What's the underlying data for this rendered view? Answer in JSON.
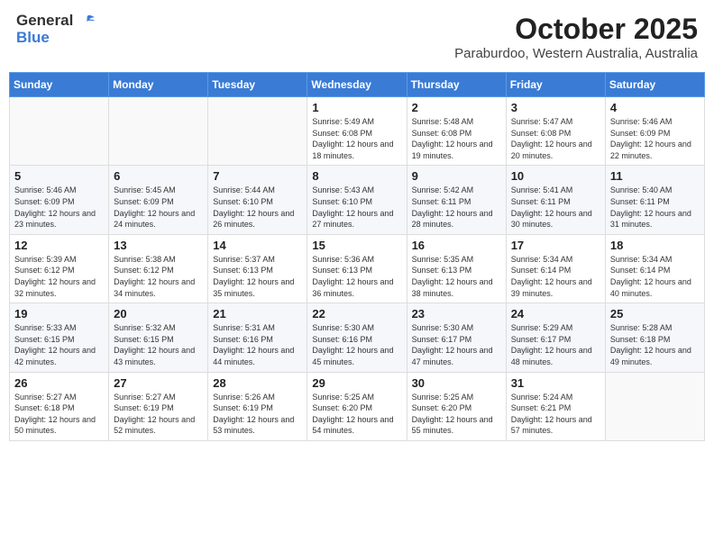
{
  "header": {
    "logo": {
      "general": "General",
      "blue": "Blue"
    },
    "title": "October 2025",
    "location": "Paraburdoo, Western Australia, Australia"
  },
  "calendar": {
    "weekdays": [
      "Sunday",
      "Monday",
      "Tuesday",
      "Wednesday",
      "Thursday",
      "Friday",
      "Saturday"
    ],
    "weeks": [
      [
        {
          "day": "",
          "info": ""
        },
        {
          "day": "",
          "info": ""
        },
        {
          "day": "",
          "info": ""
        },
        {
          "day": "1",
          "info": "Sunrise: 5:49 AM\nSunset: 6:08 PM\nDaylight: 12 hours\nand 18 minutes."
        },
        {
          "day": "2",
          "info": "Sunrise: 5:48 AM\nSunset: 6:08 PM\nDaylight: 12 hours\nand 19 minutes."
        },
        {
          "day": "3",
          "info": "Sunrise: 5:47 AM\nSunset: 6:08 PM\nDaylight: 12 hours\nand 20 minutes."
        },
        {
          "day": "4",
          "info": "Sunrise: 5:46 AM\nSunset: 6:09 PM\nDaylight: 12 hours\nand 22 minutes."
        }
      ],
      [
        {
          "day": "5",
          "info": "Sunrise: 5:46 AM\nSunset: 6:09 PM\nDaylight: 12 hours\nand 23 minutes."
        },
        {
          "day": "6",
          "info": "Sunrise: 5:45 AM\nSunset: 6:09 PM\nDaylight: 12 hours\nand 24 minutes."
        },
        {
          "day": "7",
          "info": "Sunrise: 5:44 AM\nSunset: 6:10 PM\nDaylight: 12 hours\nand 26 minutes."
        },
        {
          "day": "8",
          "info": "Sunrise: 5:43 AM\nSunset: 6:10 PM\nDaylight: 12 hours\nand 27 minutes."
        },
        {
          "day": "9",
          "info": "Sunrise: 5:42 AM\nSunset: 6:11 PM\nDaylight: 12 hours\nand 28 minutes."
        },
        {
          "day": "10",
          "info": "Sunrise: 5:41 AM\nSunset: 6:11 PM\nDaylight: 12 hours\nand 30 minutes."
        },
        {
          "day": "11",
          "info": "Sunrise: 5:40 AM\nSunset: 6:11 PM\nDaylight: 12 hours\nand 31 minutes."
        }
      ],
      [
        {
          "day": "12",
          "info": "Sunrise: 5:39 AM\nSunset: 6:12 PM\nDaylight: 12 hours\nand 32 minutes."
        },
        {
          "day": "13",
          "info": "Sunrise: 5:38 AM\nSunset: 6:12 PM\nDaylight: 12 hours\nand 34 minutes."
        },
        {
          "day": "14",
          "info": "Sunrise: 5:37 AM\nSunset: 6:13 PM\nDaylight: 12 hours\nand 35 minutes."
        },
        {
          "day": "15",
          "info": "Sunrise: 5:36 AM\nSunset: 6:13 PM\nDaylight: 12 hours\nand 36 minutes."
        },
        {
          "day": "16",
          "info": "Sunrise: 5:35 AM\nSunset: 6:13 PM\nDaylight: 12 hours\nand 38 minutes."
        },
        {
          "day": "17",
          "info": "Sunrise: 5:34 AM\nSunset: 6:14 PM\nDaylight: 12 hours\nand 39 minutes."
        },
        {
          "day": "18",
          "info": "Sunrise: 5:34 AM\nSunset: 6:14 PM\nDaylight: 12 hours\nand 40 minutes."
        }
      ],
      [
        {
          "day": "19",
          "info": "Sunrise: 5:33 AM\nSunset: 6:15 PM\nDaylight: 12 hours\nand 42 minutes."
        },
        {
          "day": "20",
          "info": "Sunrise: 5:32 AM\nSunset: 6:15 PM\nDaylight: 12 hours\nand 43 minutes."
        },
        {
          "day": "21",
          "info": "Sunrise: 5:31 AM\nSunset: 6:16 PM\nDaylight: 12 hours\nand 44 minutes."
        },
        {
          "day": "22",
          "info": "Sunrise: 5:30 AM\nSunset: 6:16 PM\nDaylight: 12 hours\nand 45 minutes."
        },
        {
          "day": "23",
          "info": "Sunrise: 5:30 AM\nSunset: 6:17 PM\nDaylight: 12 hours\nand 47 minutes."
        },
        {
          "day": "24",
          "info": "Sunrise: 5:29 AM\nSunset: 6:17 PM\nDaylight: 12 hours\nand 48 minutes."
        },
        {
          "day": "25",
          "info": "Sunrise: 5:28 AM\nSunset: 6:18 PM\nDaylight: 12 hours\nand 49 minutes."
        }
      ],
      [
        {
          "day": "26",
          "info": "Sunrise: 5:27 AM\nSunset: 6:18 PM\nDaylight: 12 hours\nand 50 minutes."
        },
        {
          "day": "27",
          "info": "Sunrise: 5:27 AM\nSunset: 6:19 PM\nDaylight: 12 hours\nand 52 minutes."
        },
        {
          "day": "28",
          "info": "Sunrise: 5:26 AM\nSunset: 6:19 PM\nDaylight: 12 hours\nand 53 minutes."
        },
        {
          "day": "29",
          "info": "Sunrise: 5:25 AM\nSunset: 6:20 PM\nDaylight: 12 hours\nand 54 minutes."
        },
        {
          "day": "30",
          "info": "Sunrise: 5:25 AM\nSunset: 6:20 PM\nDaylight: 12 hours\nand 55 minutes."
        },
        {
          "day": "31",
          "info": "Sunrise: 5:24 AM\nSunset: 6:21 PM\nDaylight: 12 hours\nand 57 minutes."
        },
        {
          "day": "",
          "info": ""
        }
      ]
    ]
  }
}
